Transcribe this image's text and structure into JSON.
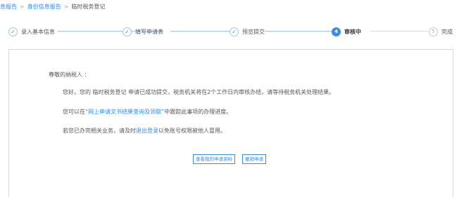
{
  "breadcrumb": {
    "item1": "息报告",
    "item2": "身份信息报告",
    "current": "临时税务登记",
    "separator": ">"
  },
  "steps": [
    {
      "number": "✓",
      "label": "录入基本信息",
      "state": "done"
    },
    {
      "number": "✓",
      "label": "填写申请表",
      "state": "done"
    },
    {
      "number": "✓",
      "label": "预览提交",
      "state": "done"
    },
    {
      "number": "4",
      "label": "审核中",
      "state": "active"
    },
    {
      "number": "5",
      "label": "完成",
      "state": "pending"
    }
  ],
  "notice": {
    "greeting": "尊敬的纳税人 ：",
    "para1": "您好。您的 临时税务登记 申请已成功提交，税务机关将在2个工作日内审核办结，请等待税务机关处理结果。",
    "para2_prefix": "您可以在",
    "para2_link": "“网上申请文书结果查询及领取”",
    "para2_suffix": "中跟踪此事项的办理进度。",
    "para3_prefix": "若您已办完相关业务，请及时",
    "para3_link": "退出登录",
    "para3_suffix": "以免账号权限被他人冒用。"
  },
  "actions": {
    "view_label": "查看我的申请资料",
    "withdraw_label": "撤销申请"
  },
  "colors": {
    "accent": "#2d8cf0",
    "step_done_border": "#9ec5ef",
    "step_active": "#3b8fe0"
  }
}
